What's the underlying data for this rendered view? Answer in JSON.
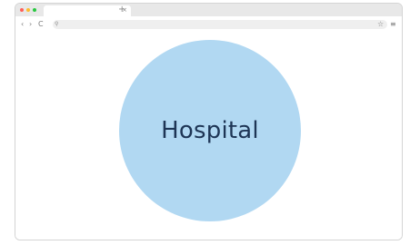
{
  "browser": {
    "tab": {
      "close_glyph": "×"
    },
    "new_tab_glyph": "+",
    "toolbar": {
      "back_glyph": "‹",
      "forward_glyph": "›",
      "reload_glyph": "C",
      "search_glyph": "⚲",
      "bookmark_glyph": "☆",
      "menu_glyph": "≡"
    },
    "traffic_lights": {
      "close_color": "#ff5f57",
      "minimize_color": "#febc2e",
      "maximize_color": "#28c840"
    }
  },
  "page": {
    "circle_label": "Hospital",
    "circle_color": "#b1d8f2",
    "label_color": "#1e3555"
  }
}
